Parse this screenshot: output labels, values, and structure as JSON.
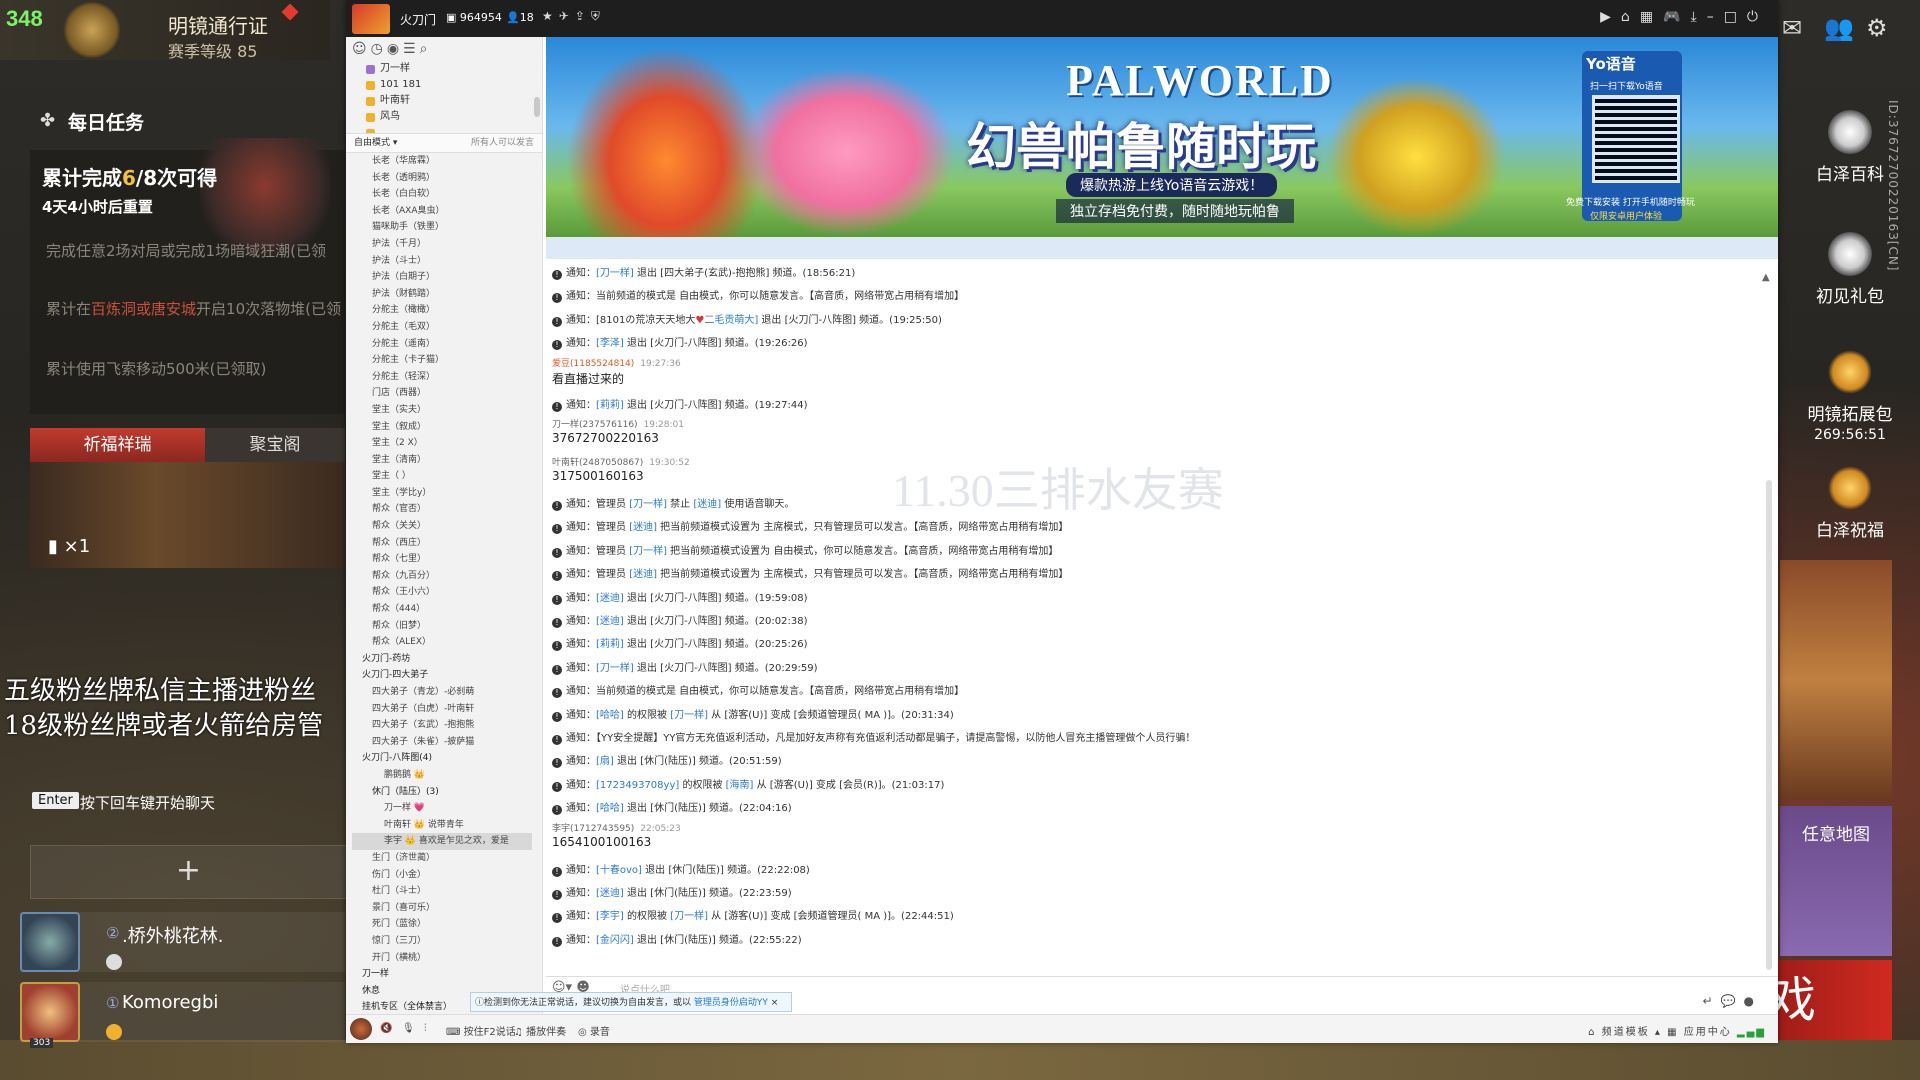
{
  "game": {
    "pass_points": "348",
    "pass_title": "明镜通行证",
    "pass_level": "赛季等级 85",
    "daily_title": "每日任务",
    "daily_progress_prefix": "累计完成",
    "daily_progress_done": "6",
    "daily_progress_total": "/8",
    "daily_progress_suffix": "次可得",
    "daily_reset": "4天4小时后重置",
    "tasks": [
      "完成任意2场对局或完成1场暗域狂潮(已领",
      "累计在",
      "百炼洞或唐安城",
      "开启10次落物堆(已领",
      "累计使用飞索移动500米(已领取)"
    ],
    "tab_pray": "祈福祥瑞",
    "tab_treasure": "聚宝阁",
    "pray_count": "×1",
    "danmaku_1": "五级粉丝牌私信主播进粉丝",
    "danmaku_2": "18级粉丝牌或者火箭给房管",
    "enter_key": "Enter",
    "enter_hint": "按下回车键开始聊天",
    "add_symbol": "+",
    "members": [
      {
        "num": "②",
        "name": ".桥外桃花林."
      },
      {
        "num": "①",
        "name": "Komoregbi",
        "level": "303"
      }
    ],
    "right_id": "ID:3767270022016З[CN]",
    "side_entries": [
      {
        "label": "白泽百科"
      },
      {
        "label": "初见礼包"
      },
      {
        "label": "明镜拓展包",
        "timer": "269:56:51"
      },
      {
        "label": "白泽祝福"
      },
      {
        "label": "任意地图"
      }
    ],
    "big_red_text": "戏"
  },
  "yy": {
    "channel_name": "火刀门",
    "channel_id": "964954",
    "online": "18",
    "banner": {
      "title_en": "PALWORLD",
      "title_cn": "幻兽帕鲁随时玩",
      "sub1": "爆款热游上线Yo语音云游戏！",
      "sub2": "独立存档免付费，随时随地玩帕鲁",
      "qr_brand": "Yo语音",
      "qr_scan": "扫一扫下载Yo语音",
      "qr_note1": "免费下载安装 打开手机随时畅玩",
      "qr_note2": "仅限安卓用户体验"
    },
    "mode_left": "自由模式 ▾",
    "mode_right": "所有人可以发言",
    "favorites": [
      "刀一样",
      "101 181",
      "叶南轩",
      "风鸟",
      "..."
    ],
    "tree": [
      {
        "t": "长老（华席霖）",
        "c": "l2"
      },
      {
        "t": "长老（透明鸦）",
        "c": "l2"
      },
      {
        "t": "长老（白白软）",
        "c": "l2"
      },
      {
        "t": "长老（AXA臭虫）",
        "c": "l2"
      },
      {
        "t": "猫咪助手（铁墨）",
        "c": "l2"
      },
      {
        "t": "护法（千月）",
        "c": "l2"
      },
      {
        "t": "护法（斗士）",
        "c": "l2"
      },
      {
        "t": "护法（白期子）",
        "c": "l2"
      },
      {
        "t": "护法（财鹤踏）",
        "c": "l2"
      },
      {
        "t": "分舵主（橄橄）",
        "c": "l2"
      },
      {
        "t": "分舵主（毛双）",
        "c": "l2"
      },
      {
        "t": "分舵主（遥南）",
        "c": "l2"
      },
      {
        "t": "分舵主（卡子猫）",
        "c": "l2"
      },
      {
        "t": "分舵主（轻深）",
        "c": "l2"
      },
      {
        "t": "门店（西器）",
        "c": "l2"
      },
      {
        "t": "堂主（实夫）",
        "c": "l2"
      },
      {
        "t": "堂主（叙成）",
        "c": "l2"
      },
      {
        "t": "堂主（2 X）",
        "c": "l2"
      },
      {
        "t": "堂主（清南）",
        "c": "l2"
      },
      {
        "t": "堂主（ ）",
        "c": "l2"
      },
      {
        "t": "堂主（学比y）",
        "c": "l2"
      },
      {
        "t": "帮众（官否）",
        "c": "l2"
      },
      {
        "t": "帮众（关关）",
        "c": "l2"
      },
      {
        "t": "帮众（西庄）",
        "c": "l2"
      },
      {
        "t": "帮众（七里）",
        "c": "l2"
      },
      {
        "t": "帮众（九百分）",
        "c": "l2"
      },
      {
        "t": "帮众（王小六）",
        "c": "l2"
      },
      {
        "t": "帮众（444）",
        "c": "l2"
      },
      {
        "t": "帮众（旧梦）",
        "c": "l2"
      },
      {
        "t": "帮众（ALEX）",
        "c": "l2"
      },
      {
        "t": "火刀门-药坊",
        "c": "l1 group"
      },
      {
        "t": "火刀门-四大弟子",
        "c": "l1 group"
      },
      {
        "t": "四大弟子（青龙）-必刹萌",
        "c": "l2"
      },
      {
        "t": "四大弟子（白虎）-叶南轩",
        "c": "l2"
      },
      {
        "t": "四大弟子（玄武）-抱抱熊",
        "c": "l2"
      },
      {
        "t": "四大弟子（朱雀）-披萨猫",
        "c": "l2"
      },
      {
        "t": "火刀门-八阵图(4)",
        "c": "l1 group"
      },
      {
        "t": "鹏鹅鹅 👑",
        "c": "l3"
      },
      {
        "t": "休门（陆压）(3)",
        "c": "l2 group"
      },
      {
        "t": "刀一样 💗",
        "c": "l3"
      },
      {
        "t": "叶南轩 👑 说带青年",
        "c": "l3"
      },
      {
        "t": "李宇 👑 喜欢是乍见之欢，爱是",
        "c": "l3 sel"
      },
      {
        "t": "生门（济世蔺）",
        "c": "l2"
      },
      {
        "t": "伤门（小金）",
        "c": "l2"
      },
      {
        "t": "杜门（斗士）",
        "c": "l2"
      },
      {
        "t": "景门（喜可乐）",
        "c": "l2"
      },
      {
        "t": "死门（蓝徐）",
        "c": "l2"
      },
      {
        "t": "惊门（三刀）",
        "c": "l2"
      },
      {
        "t": "开门（横桃）",
        "c": "l2"
      },
      {
        "t": "刀一样",
        "c": "l1 group"
      },
      {
        "t": "休息",
        "c": "l1 group"
      },
      {
        "t": "挂机专区（全体禁言）",
        "c": "l1 group"
      }
    ],
    "watermark": "11.30三排水友赛",
    "chat": [
      {
        "type": "sys",
        "parts": [
          [
            "通知：",
            ""
          ],
          [
            "[刀一样]",
            "lk"
          ],
          [
            " 退出 [四大弟子(玄武)-抱抱熊] 频道。(18:56:21)",
            ""
          ]
        ]
      },
      {
        "type": "sys",
        "parts": [
          [
            "通知：当前频道的模式是 自由模式，你可以随意发言。【高音质，网络带宽占用稍有增加】",
            ""
          ]
        ]
      },
      {
        "type": "sys",
        "parts": [
          [
            "通知：",
            ""
          ],
          [
            "[8101の荒凉天天地大",
            ""
          ],
          [
            "♥",
            "rd"
          ],
          [
            "二毛贡萌大]",
            "lk"
          ],
          [
            " 退出 [火刀门-八阵图] 频道。(19:25:50)",
            ""
          ]
        ]
      },
      {
        "type": "sys",
        "parts": [
          [
            "通知：",
            ""
          ],
          [
            "[李泽]",
            "lk"
          ],
          [
            " 退出 [火刀门-八阵图] 频道。(19:26:26)",
            ""
          ]
        ]
      },
      {
        "type": "user",
        "name": "爱豆(1185524814)",
        "time": "19:27:36",
        "text": "看直播过来的"
      },
      {
        "type": "sys",
        "parts": [
          [
            "通知：",
            ""
          ],
          [
            "[莉莉]",
            "lk"
          ],
          [
            " 退出 [火刀门-八阵图] 频道。(19:27:44)",
            ""
          ]
        ]
      },
      {
        "type": "user",
        "name": "刀一样(237576116)",
        "time": "19:28:01",
        "text": "37672700220163",
        "gray": true
      },
      {
        "type": "user",
        "name": "叶南轩(2487050867)",
        "time": "19:30:52",
        "text": "317500160163",
        "gray": true
      },
      {
        "type": "sys",
        "parts": [
          [
            "通知：管理员 ",
            ""
          ],
          [
            "[刀一样]",
            "lk"
          ],
          [
            " 禁止 ",
            ""
          ],
          [
            "[迷迪]",
            "lk"
          ],
          [
            " 使用语音聊天。",
            ""
          ]
        ]
      },
      {
        "type": "sys",
        "parts": [
          [
            "通知：管理员 ",
            ""
          ],
          [
            "[迷迪]",
            "lk"
          ],
          [
            " 把当前频道模式设置为 主席模式，只有管理员可以发言。【高音质，网络带宽占用稍有增加】",
            ""
          ]
        ]
      },
      {
        "type": "sys",
        "parts": [
          [
            "通知：管理员 ",
            ""
          ],
          [
            "[刀一样]",
            "lk"
          ],
          [
            " 把当前频道模式设置为 自由模式，你可以随意发言。【高音质，网络带宽占用稍有增加】",
            ""
          ]
        ]
      },
      {
        "type": "sys",
        "parts": [
          [
            "通知：管理员 ",
            ""
          ],
          [
            "[迷迪]",
            "lk"
          ],
          [
            " 把当前频道模式设置为 主席模式，只有管理员可以发言。【高音质，网络带宽占用稍有增加】",
            ""
          ]
        ]
      },
      {
        "type": "sys",
        "parts": [
          [
            "通知：",
            ""
          ],
          [
            "[迷迪]",
            "lk"
          ],
          [
            " 退出 [火刀门-八阵图] 频道。(19:59:08)",
            ""
          ]
        ]
      },
      {
        "type": "sys",
        "parts": [
          [
            "通知：",
            ""
          ],
          [
            "[迷迪]",
            "lk"
          ],
          [
            " 退出 [火刀门-八阵图] 频道。(20:02:38)",
            ""
          ]
        ]
      },
      {
        "type": "sys",
        "parts": [
          [
            "通知：",
            ""
          ],
          [
            "[莉莉]",
            "lk"
          ],
          [
            " 退出 [火刀门-八阵图] 频道。(20:25:26)",
            ""
          ]
        ]
      },
      {
        "type": "sys",
        "parts": [
          [
            "通知：",
            ""
          ],
          [
            "[刀一样]",
            "lk"
          ],
          [
            " 退出 [火刀门-八阵图] 频道。(20:29:59)",
            ""
          ]
        ]
      },
      {
        "type": "sys",
        "parts": [
          [
            "通知：当前频道的模式是 自由模式，你可以随意发言。【高音质，网络带宽占用稍有增加】",
            ""
          ]
        ]
      },
      {
        "type": "sys",
        "parts": [
          [
            "通知：",
            ""
          ],
          [
            "[哈哈]",
            "lk"
          ],
          [
            " 的权限被 ",
            ""
          ],
          [
            "[刀一样]",
            "lk"
          ],
          [
            " 从 [游客(U)] 变成 [会频道管理员( MA )]。(20:31:34)",
            ""
          ]
        ]
      },
      {
        "type": "sys",
        "parts": [
          [
            "通知：【YY安全提醒】YY官方无充值返利活动，凡是加好友声称有充值返利活动都是骗子，请提高警惕，以防他人冒充主播管理做个人员行骗！",
            ""
          ]
        ]
      },
      {
        "type": "sys",
        "parts": [
          [
            "通知：",
            ""
          ],
          [
            "[扇]",
            "lk"
          ],
          [
            " 退出 [休门(陆压)] 频道。(20:51:59)",
            ""
          ]
        ]
      },
      {
        "type": "sys",
        "parts": [
          [
            "通知：",
            ""
          ],
          [
            "[1723493708yy]",
            "lk"
          ],
          [
            " 的权限被 ",
            ""
          ],
          [
            "[海南]",
            "lk"
          ],
          [
            " 从 [游客(U)] 变成 [会员(R)]。(21:03:17)",
            ""
          ]
        ]
      },
      {
        "type": "sys",
        "parts": [
          [
            "通知：",
            ""
          ],
          [
            "[哈哈]",
            "lk"
          ],
          [
            " 退出 [休门(陆压)] 频道。(22:04:16)",
            ""
          ]
        ]
      },
      {
        "type": "user",
        "name": "李宇(1712743595)",
        "time": "22:05:23",
        "text": "1654100100163",
        "gray": true
      },
      {
        "type": "sys",
        "parts": [
          [
            "通知：",
            ""
          ],
          [
            "[十春ovo]",
            "lk"
          ],
          [
            " 退出 [休门(陆压)] 频道。(22:22:08)",
            ""
          ]
        ]
      },
      {
        "type": "sys",
        "parts": [
          [
            "通知：",
            ""
          ],
          [
            "[迷迪]",
            "lk"
          ],
          [
            " 退出 [休门(陆压)] 频道。(22:23:59)",
            ""
          ]
        ]
      },
      {
        "type": "sys",
        "parts": [
          [
            "通知：",
            ""
          ],
          [
            "[李宇]",
            "lk"
          ],
          [
            " 的权限被 ",
            ""
          ],
          [
            "[刀一样]",
            "lk"
          ],
          [
            " 从 [游客(U)] 变成 [会频道管理员( MA )]。(22:44:51)",
            ""
          ]
        ]
      },
      {
        "type": "sys",
        "parts": [
          [
            "通知：",
            ""
          ],
          [
            "[金闪闪]",
            "lk"
          ],
          [
            " 退出 [休门(陆压)] 频道。(22:55:22)",
            ""
          ]
        ]
      }
    ],
    "input_placeholder": "说点什么吧...",
    "tip_text": "检测到你无法正常说话，建议切换为自由发言，或以 ",
    "tip_link": "管理员身份启动YY",
    "status": {
      "item1": "按住F2说话",
      "item2": "播放伴奏",
      "item3": "录音",
      "right1": "频道模板 ▴",
      "right2": "应用中心"
    }
  },
  "colors": {
    "accent_link": "#2a7ad0",
    "titlebar": "#1e1e1e",
    "game_red": "#c23a2e"
  }
}
